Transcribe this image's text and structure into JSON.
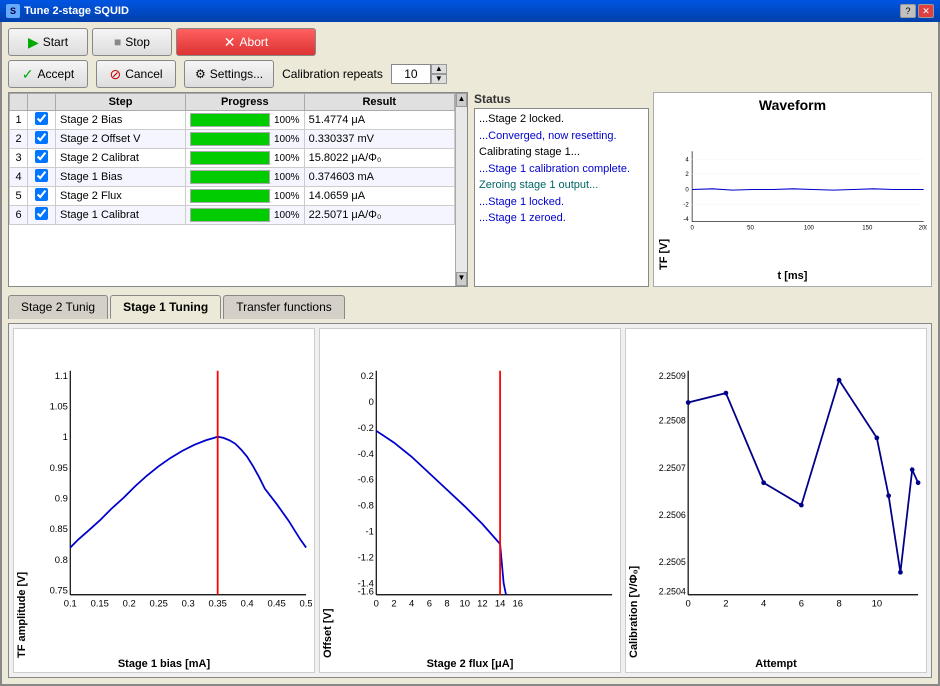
{
  "window": {
    "title": "Tune 2-stage SQUID"
  },
  "toolbar": {
    "start_label": "Start",
    "stop_label": "Stop",
    "abort_label": "Abort",
    "accept_label": "Accept",
    "cancel_label": "Cancel",
    "settings_label": "Settings...",
    "cal_repeats_label": "Calibration repeats",
    "cal_repeats_value": "10"
  },
  "status": {
    "label": "Status",
    "lines": [
      {
        "text": "...Stage 2 locked.",
        "style": "normal"
      },
      {
        "text": "...Converged, now resetting.",
        "style": "blue"
      },
      {
        "text": "Calibrating stage 1...",
        "style": "normal"
      },
      {
        "text": "...Stage 1 calibration complete.",
        "style": "blue"
      },
      {
        "text": "Zeroing stage 1 output...",
        "style": "teal"
      },
      {
        "text": "...Stage 1 locked.",
        "style": "blue"
      },
      {
        "text": "...Stage 1 zeroed.",
        "style": "blue"
      }
    ]
  },
  "waveform": {
    "title": "Waveform",
    "y_label": "TF [V]",
    "x_label": "t [ms]",
    "x_ticks": [
      "0",
      "50",
      "100",
      "150",
      "200"
    ],
    "y_ticks": [
      "4",
      "2",
      "0",
      "-2",
      "-4"
    ]
  },
  "cal_table": {
    "headers": [
      "",
      "",
      "Step",
      "Progress",
      "Result"
    ],
    "rows": [
      {
        "num": "1",
        "checked": true,
        "step": "Stage 2 Bias",
        "progress": 100,
        "result": "51.4774 μA"
      },
      {
        "num": "2",
        "checked": true,
        "step": "Stage 2 Offset V",
        "progress": 100,
        "result": "0.330337 mV"
      },
      {
        "num": "3",
        "checked": true,
        "step": "Stage 2 Calibrat",
        "progress": 100,
        "result": "15.8022 μA/Φ₀"
      },
      {
        "num": "4",
        "checked": true,
        "step": "Stage 1 Bias",
        "progress": 100,
        "result": "0.374603 mA"
      },
      {
        "num": "5",
        "checked": true,
        "step": "Stage 2 Flux",
        "progress": 100,
        "result": "14.0659 μA"
      },
      {
        "num": "6",
        "checked": true,
        "step": "Stage 1 Calibrat",
        "progress": 100,
        "result": "22.5071 μA/Φ₀"
      }
    ]
  },
  "tabs": [
    {
      "id": "stage2",
      "label": "Stage 2 Tunig"
    },
    {
      "id": "stage1",
      "label": "Stage 1 Tuning",
      "active": true
    },
    {
      "id": "transfer",
      "label": "Transfer functions"
    }
  ],
  "chart1": {
    "title": "",
    "y_label": "TF amplitude [V]",
    "x_label": "Stage 1 bias [mA]",
    "x_ticks": [
      "0.1",
      "0.15",
      "0.2",
      "0.25",
      "0.3",
      "0.35",
      "0.4",
      "0.45",
      "0.5"
    ],
    "y_min": 0.75,
    "y_max": 1.1,
    "y_ticks": [
      "1.1",
      "1.05",
      "1",
      "0.95",
      "0.9",
      "0.85",
      "0.8",
      "0.75"
    ],
    "red_x": 0.35
  },
  "chart2": {
    "title": "",
    "y_label": "Offset [V]",
    "x_label": "Stage 2 flux [μA]",
    "x_ticks": [
      "0",
      "2",
      "4",
      "6",
      "8",
      "10",
      "12",
      "14",
      "16"
    ],
    "y_min": -1.6,
    "y_max": 0.2,
    "y_ticks": [
      "0.2",
      "0",
      "-0.2",
      "-0.4",
      "-0.6",
      "-0.8",
      "-1",
      "-1.2",
      "-1.4",
      "-1.6"
    ],
    "red_x": 14
  },
  "chart3": {
    "title": "",
    "y_label": "Calibration [V/Φ₀]",
    "x_label": "Attempt",
    "x_ticks": [
      "0",
      "2",
      "4",
      "6",
      "8",
      "10"
    ],
    "y_min": 2.2504,
    "y_max": 2.2509,
    "y_ticks": [
      "2.2509",
      "2.2508",
      "2.2507",
      "2.2506",
      "2.2505",
      "2.2504"
    ]
  }
}
